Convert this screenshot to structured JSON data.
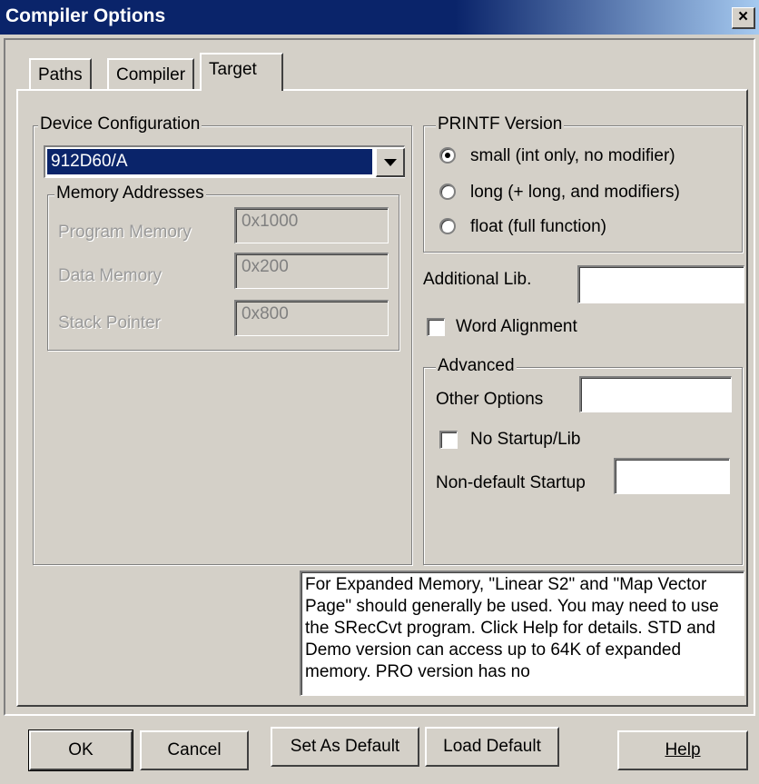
{
  "window": {
    "title": "Compiler Options",
    "close_label": "×"
  },
  "tabs": [
    {
      "label": "Paths"
    },
    {
      "label": "Compiler"
    },
    {
      "label": "Target"
    }
  ],
  "device_config": {
    "legend": "Device Configuration",
    "selected": "912D60/A"
  },
  "memory": {
    "legend": "Memory Addresses",
    "program_label": "Program Memory",
    "program_value": "0x1000",
    "data_label": "Data Memory",
    "data_value": "0x200",
    "stack_label": "Stack Pointer",
    "stack_value": "0x800"
  },
  "printf": {
    "legend": "PRINTF Version",
    "options": [
      {
        "label": "small (int only, no modifier)",
        "selected": true
      },
      {
        "label": "long (+ long, and modifiers)",
        "selected": false
      },
      {
        "label": "float (full function)",
        "selected": false
      }
    ]
  },
  "additional_lib": {
    "label": "Additional Lib.",
    "value": ""
  },
  "word_alignment": {
    "label": "Word Alignment",
    "checked": false
  },
  "advanced": {
    "legend": "Advanced",
    "other_label": "Other Options",
    "other_value": "",
    "no_startup_label": "No Startup/Lib",
    "no_startup_checked": false,
    "nondefault_label": "Non-default Startup",
    "nondefault_value": ""
  },
  "info_text": "For Expanded Memory, \"Linear S2\" and \"Map Vector Page\" should generally be used. You may need to use the SRecCvt program. Click Help for details.  STD and Demo version can access up to 64K of expanded memory. PRO version has no",
  "buttons": {
    "ok": "OK",
    "cancel": "Cancel",
    "set_default": "Set As Default",
    "load_default": "Load Default",
    "help": "Help"
  }
}
